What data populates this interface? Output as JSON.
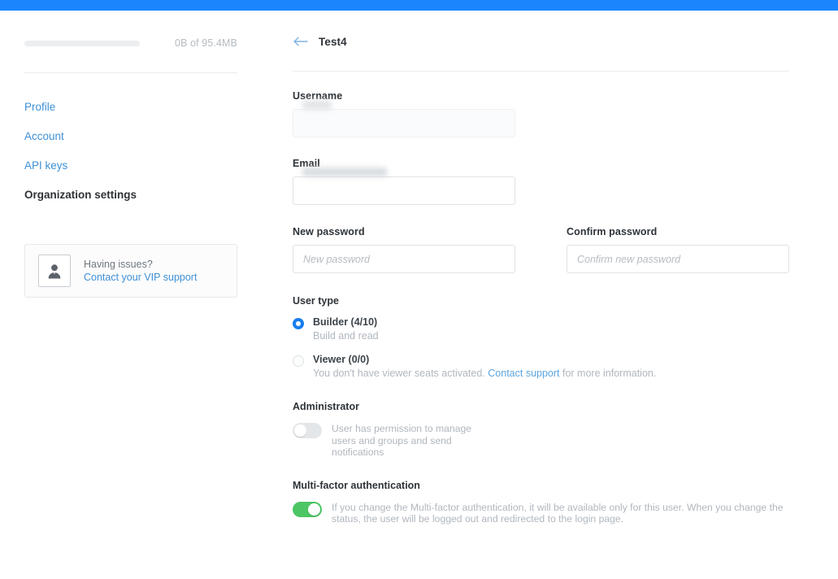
{
  "theme": {
    "accent_blue": "#1a85fc",
    "link_blue": "#3e90d6",
    "radio_blue": "#1a7ef0",
    "toggle_green": "#4cc664"
  },
  "sidebar": {
    "storage": {
      "used_label": "0B of 95.4MB",
      "percent": 0
    },
    "nav_items": [
      {
        "label": "Profile",
        "active": false
      },
      {
        "label": "Account",
        "active": false
      },
      {
        "label": "API keys",
        "active": false
      },
      {
        "label": "Organization settings",
        "active": true
      }
    ],
    "support_card": {
      "icon": "user-avatar-icon",
      "title": "Having issues?",
      "link_label": "Contact your VIP support"
    }
  },
  "content": {
    "header": {
      "back_icon": "arrow-left-icon",
      "title": "Test4"
    },
    "fields": {
      "username": {
        "label": "Username",
        "value": "",
        "placeholder": "",
        "disabled": true,
        "redacted": true
      },
      "email": {
        "label": "Email",
        "value": "",
        "placeholder": "",
        "disabled": false,
        "redacted": true
      },
      "new_password": {
        "label": "New password",
        "value": "",
        "placeholder": "New password"
      },
      "confirm_password": {
        "label": "Confirm password",
        "value": "",
        "placeholder": "Confirm new password"
      }
    },
    "user_type": {
      "title": "User type",
      "options": [
        {
          "label": "Builder (4/10)",
          "description": "Build and read",
          "selected": true
        },
        {
          "label": "Viewer (0/0)",
          "description_before": "You don't have viewer seats activated.",
          "link_label": "Contact support",
          "description_after": "for more information.",
          "selected": false
        }
      ]
    },
    "administrator": {
      "title": "Administrator",
      "enabled": false,
      "description": "User has permission to manage users and groups and send notifications"
    },
    "mfa": {
      "title": "Multi-factor authentication",
      "enabled": true,
      "description": "If you change the Multi-factor authentication, it will be available only for this user. When you change the status, the user will be logged out and redirected to the login page."
    }
  }
}
